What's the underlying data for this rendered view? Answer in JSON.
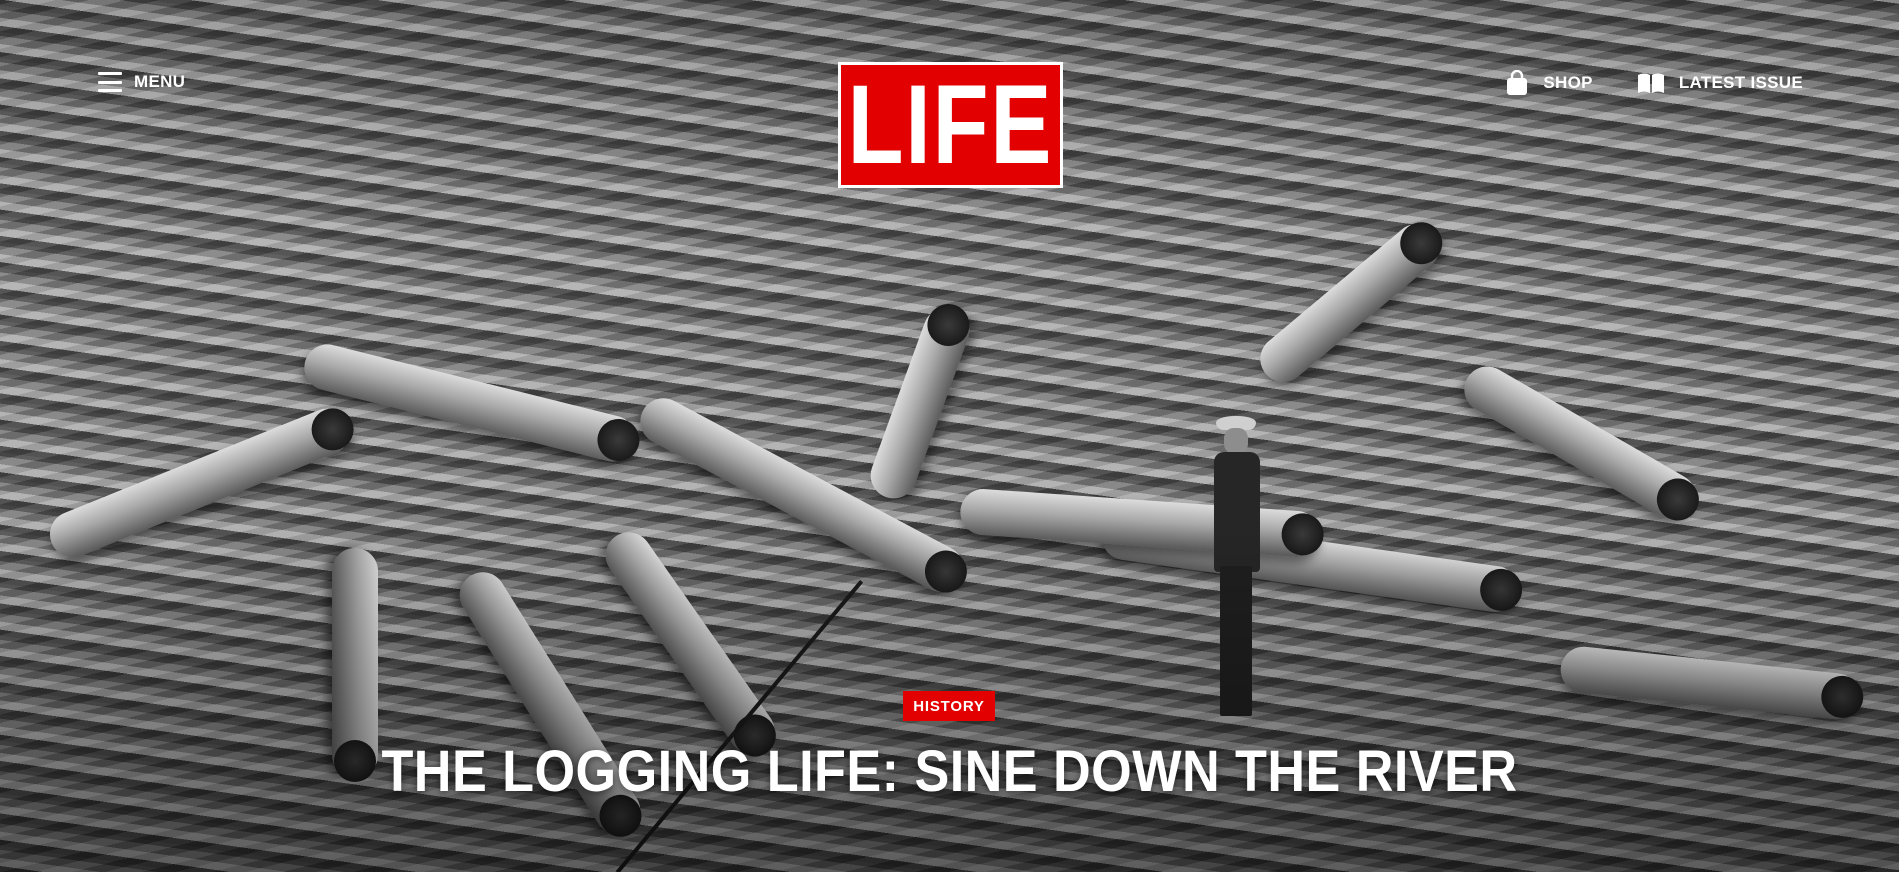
{
  "header": {
    "menu_label": "MENU",
    "logo_text": "LIFE",
    "shop_label": "SHOP",
    "latest_issue_label": "LATEST ISSUE",
    "icons": {
      "menu": "hamburger-icon",
      "shop": "shopping-bag-icon",
      "latest_issue": "open-book-icon"
    }
  },
  "article": {
    "category": "HISTORY",
    "title": "THE LOGGING LIFE: SINE DOWN THE RIVER"
  },
  "colors": {
    "brand_red": "#e20000",
    "text": "#ffffff"
  }
}
